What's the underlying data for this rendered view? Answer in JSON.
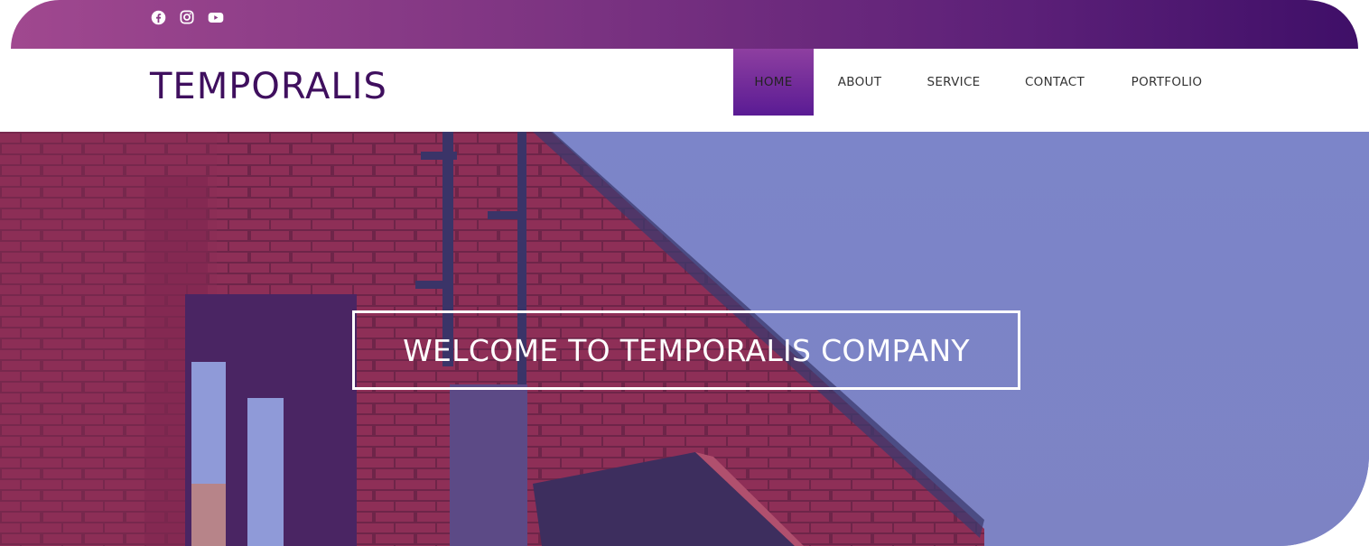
{
  "social": {
    "icons": [
      "facebook-icon",
      "instagram-icon",
      "youtube-icon"
    ]
  },
  "brand": {
    "name": "TEMPORALIS"
  },
  "nav": {
    "items": [
      {
        "label": "HOME",
        "active": true
      },
      {
        "label": "ABOUT",
        "active": false
      },
      {
        "label": "SERVICE",
        "active": false
      },
      {
        "label": "CONTACT",
        "active": false
      },
      {
        "label": "PORTFOLIO",
        "active": false
      }
    ]
  },
  "hero": {
    "title": "WELCOME TO TEMPORALIS COMPANY"
  },
  "colors": {
    "brand": "#3f0f5e",
    "topbar_start": "#a0488f",
    "topbar_end": "#3f0f68",
    "active_nav": "#5a1b94",
    "sky": "#7a83c6",
    "brick": "#8e2f57"
  }
}
